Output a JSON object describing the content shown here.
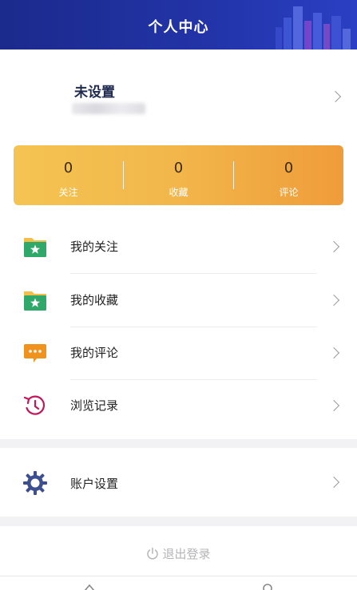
{
  "header": {
    "title": "个人中心"
  },
  "profile": {
    "name": "未设置"
  },
  "stats": [
    {
      "value": "0",
      "label": "关注"
    },
    {
      "value": "0",
      "label": "收藏"
    },
    {
      "value": "0",
      "label": "评论"
    }
  ],
  "menu": {
    "items": [
      {
        "label": "我的关注",
        "icon": "folder-star-icon"
      },
      {
        "label": "我的收藏",
        "icon": "folder-star-icon"
      },
      {
        "label": "我的评论",
        "icon": "chat-bubble-icon"
      },
      {
        "label": "浏览记录",
        "icon": "history-clock-icon"
      }
    ]
  },
  "settings": {
    "label": "账户设置",
    "icon": "gear-icon"
  },
  "logout": {
    "label": "退出登录",
    "icon": "power-icon"
  },
  "tabbar": {
    "icons": [
      "home-icon",
      "user-icon"
    ]
  },
  "colors": {
    "header": "#2233a6",
    "stats_start": "#f4c452",
    "stats_end": "#ef9c3a",
    "folder_green": "#2fa86a",
    "folder_yellow": "#f2c04a",
    "comment_orange": "#f0921e",
    "history_magenta": "#c2185b",
    "gear_blue": "#3d4f8f"
  }
}
